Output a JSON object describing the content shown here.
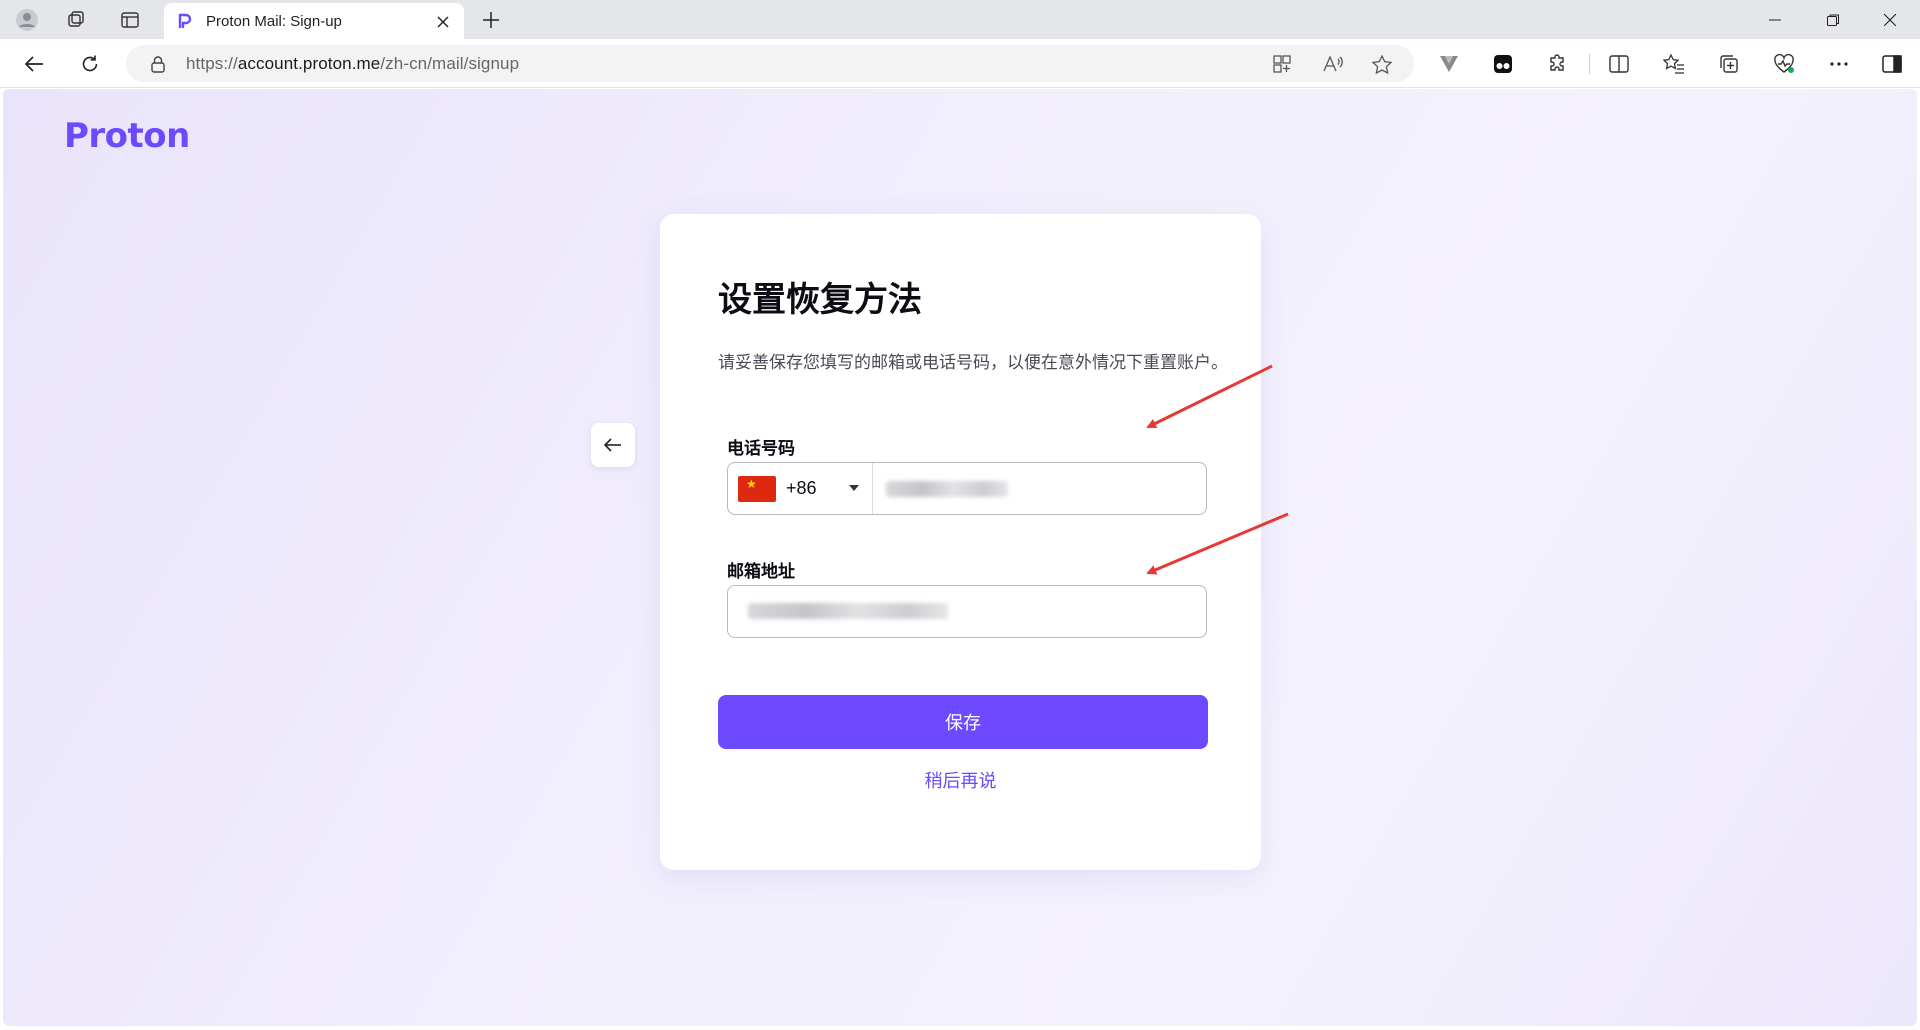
{
  "browser": {
    "tab_title": "Proton Mail: Sign-up",
    "url_scheme": "https://",
    "url_host": "account.proton.me",
    "url_path": "/zh-cn/mail/signup"
  },
  "page": {
    "logo": "Proton",
    "title": "设置恢复方法",
    "description": "请妥善保存您填写的邮箱或电话号码，以便在意外情况下重置账户。",
    "phone": {
      "label": "电话号码",
      "dial_code": "+86",
      "country_flag": "china-flag"
    },
    "email": {
      "label": "邮箱地址"
    },
    "save_label": "保存",
    "later_label": "稍后再说"
  },
  "colors": {
    "accent": "#6d4aff",
    "annotation_arrow": "#e53935"
  }
}
